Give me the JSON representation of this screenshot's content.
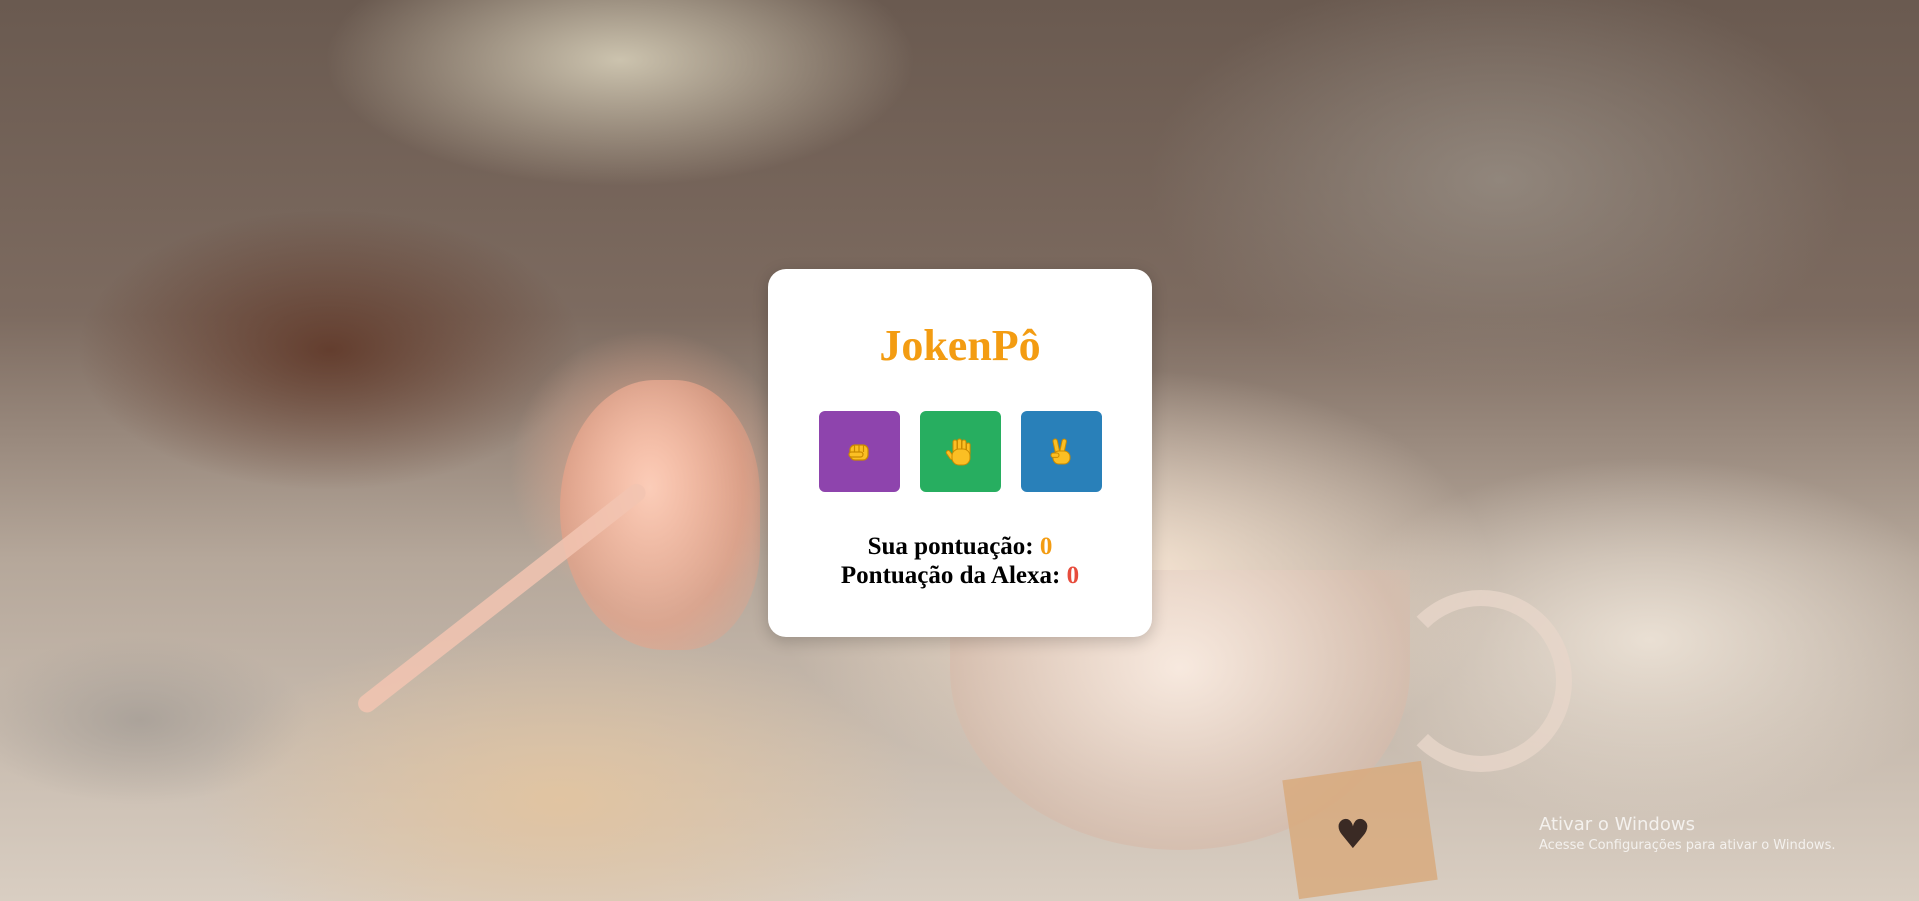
{
  "game": {
    "title": "JokenPô",
    "choices": [
      {
        "icon": "fist-icon",
        "color": "#8e44ad"
      },
      {
        "icon": "raised-hand-icon",
        "color": "#27ae60"
      },
      {
        "icon": "victory-hand-icon",
        "color": "#2980b9"
      }
    ],
    "user_score_label": "Sua pontuação:",
    "user_score": "0",
    "alexa_score_label": "Pontuação da Alexa:",
    "alexa_score": "0"
  },
  "colors": {
    "title": "#f39c12",
    "user_score": "#f39c12",
    "alexa_score": "#e74c3c",
    "icon_fill": "#fbbf24"
  },
  "watermark": {
    "title": "Ativar o Windows",
    "subtitle": "Acesse Configurações para ativar o Windows."
  }
}
